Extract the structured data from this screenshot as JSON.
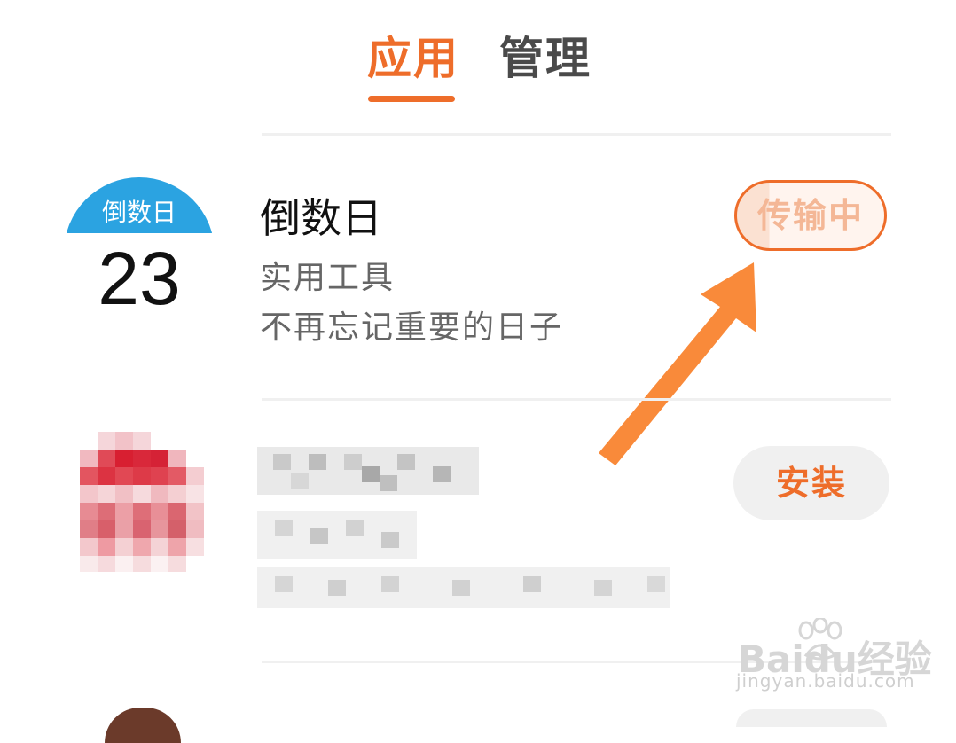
{
  "tabs": [
    {
      "label": "应用",
      "active": true
    },
    {
      "label": "管理",
      "active": false
    }
  ],
  "app": {
    "icon_top_label": "倒数日",
    "icon_number": "23",
    "name": "倒数日",
    "category": "实用工具",
    "description": "不再忘记重要的日子",
    "status_button": "传输中",
    "progress": 0.22
  },
  "second_app": {
    "install_button": "安装"
  },
  "watermark": {
    "title": "Baidu经验",
    "url": "jingyan.baidu.com"
  },
  "colors": {
    "accent": "#ee6d2a",
    "icon_blue": "#2ba3e1",
    "arrow": "#f98a3a"
  }
}
